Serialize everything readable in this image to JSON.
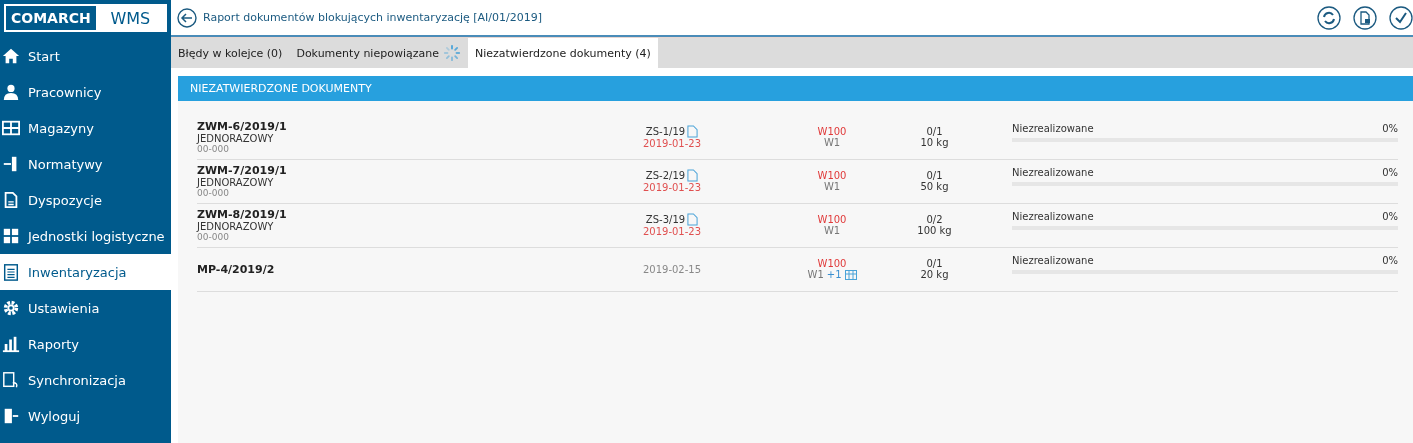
{
  "logo": {
    "brand": "COMARCH",
    "product": "WMS"
  },
  "sidebar": {
    "items": [
      {
        "label": "Start",
        "selected": false
      },
      {
        "label": "Pracownicy",
        "selected": false
      },
      {
        "label": "Magazyny",
        "selected": false
      },
      {
        "label": "Normatywy",
        "selected": false
      },
      {
        "label": "Dyspozycje",
        "selected": false
      },
      {
        "label": "Jednostki logistyczne",
        "selected": false
      },
      {
        "label": "Inwentaryzacja",
        "selected": true
      },
      {
        "label": "Ustawienia",
        "selected": false
      },
      {
        "label": "Raporty",
        "selected": false
      },
      {
        "label": "Synchronizacja",
        "selected": false
      },
      {
        "label": "Wyloguj",
        "selected": false
      }
    ]
  },
  "header": {
    "title": "Raport dokumentów blokujących inwentaryzację [AI/01/2019]"
  },
  "tabs": [
    {
      "label": "Błędy w kolejce (0)",
      "selected": false,
      "loading": false
    },
    {
      "label": "Dokumenty niepowiązane",
      "selected": false,
      "loading": true
    },
    {
      "label": "Niezatwierdzone dokumenty (4)",
      "selected": true,
      "loading": false
    }
  ],
  "section": {
    "title": "NIEZATWIERDZONE DOKUMENTY"
  },
  "rows": [
    {
      "number": "ZWM-6/2019/1",
      "type": "JEDNORAZOWY",
      "code": "00-000",
      "document": "ZS-1/19",
      "date": "2019-01-23",
      "date_highlighted": true,
      "warehouse": "W100",
      "location": "W1",
      "quantity": "0/1",
      "weight": "10 kg",
      "status": "Niezrealizowane",
      "level": 0,
      "percent": "0%"
    },
    {
      "number": "ZWM-7/2019/1",
      "type": "JEDNORAZOWY",
      "code": "00-000",
      "document": "ZS-2/19",
      "date": "2019-01-23",
      "date_highlighted": true,
      "warehouse": "W100",
      "location": "W1",
      "quantity": "0/1",
      "weight": "50 kg",
      "status": "Niezrealizowane",
      "level": 0,
      "percent": "0%"
    },
    {
      "number": "ZWM-8/2019/1",
      "type": "JEDNORAZOWY",
      "code": "00-000",
      "document": "ZS-3/19",
      "date": "2019-01-23",
      "date_highlighted": true,
      "warehouse": "W100",
      "location": "W1",
      "quantity": "0/2",
      "weight": "100 kg",
      "status": "Niezrealizowane",
      "level": 0,
      "percent": "0%"
    },
    {
      "number": "MP-4/2019/2",
      "date": "2019-02-15",
      "date_highlighted": false,
      "warehouse": "W100",
      "location": "W1",
      "extra_locations": "+1",
      "quantity": "0/1",
      "weight": "20 kg",
      "status": "Niezrealizowane",
      "level": 0,
      "percent": "0%"
    }
  ]
}
